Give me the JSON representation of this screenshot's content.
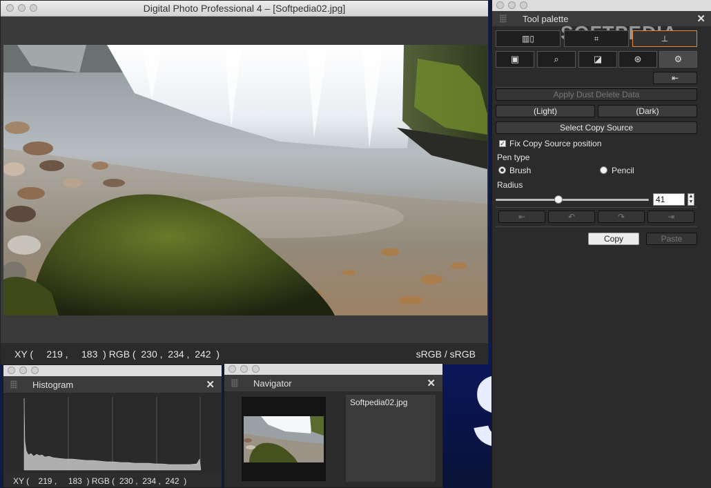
{
  "main_window": {
    "title": "Digital Photo Professional 4 – [Softpedia02.jpg]",
    "status": {
      "xy_readout": "XY (     219 ,     183  ) RGB (  230 ,  234 ,  242  )",
      "color_space": "sRGB / sRGB"
    }
  },
  "tool_palette": {
    "title": "Tool palette",
    "watermark": "SOFTPEDIA",
    "tool_buttons": [
      {
        "icon": "filmstrip-icon"
      },
      {
        "icon": "crop-icon"
      },
      {
        "icon": "stamp-icon",
        "selected": true
      }
    ],
    "tabs": [
      {
        "icon": "gradient-icon"
      },
      {
        "icon": "magnify-icon"
      },
      {
        "icon": "curve-icon"
      },
      {
        "icon": "color-wheel-icon"
      },
      {
        "icon": "gear-icon",
        "selected": true
      }
    ],
    "apply_dust_delete": "Apply Dust Delete Data",
    "light_button": "(Light)",
    "dark_button": "(Dark)",
    "select_copy_source": "Select Copy Source",
    "fix_copy_source": "Fix Copy Source position",
    "fix_copy_source_checked": true,
    "pen_type_label": "Pen type",
    "pen_options": [
      {
        "label": "Brush",
        "selected": true
      },
      {
        "label": "Pencil",
        "selected": false
      }
    ],
    "radius_label": "Radius",
    "radius_value": "41",
    "radius_min": 0,
    "radius_max": 100,
    "copy_button": "Copy",
    "paste_button": "Paste"
  },
  "histogram": {
    "title": "Histogram",
    "xy_readout": "XY (    219 ,     183  ) RGB (  230 ,  234 ,  242  )"
  },
  "navigator": {
    "title": "Navigator",
    "filename": "Softpedia02.jpg"
  },
  "desktop": {
    "partial_letter": "S"
  }
}
